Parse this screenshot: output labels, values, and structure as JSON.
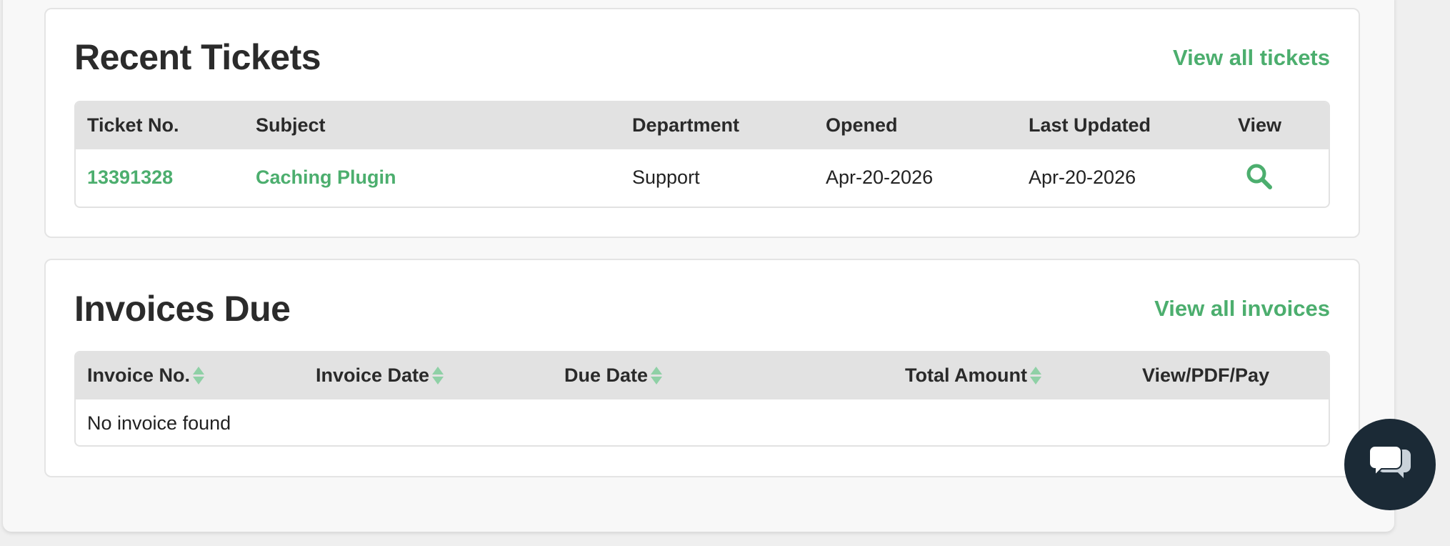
{
  "recent_tickets": {
    "title": "Recent Tickets",
    "view_all_label": "View all tickets",
    "columns": [
      "Ticket No.",
      "Subject",
      "Department",
      "Opened",
      "Last Updated",
      "View"
    ],
    "rows": [
      {
        "ticket_no": "13391328",
        "subject": "Caching Plugin",
        "department": "Support",
        "opened": "Apr-20-2026",
        "last_updated": "Apr-20-2026",
        "view_icon": "search-icon"
      }
    ]
  },
  "invoices_due": {
    "title": "Invoices Due",
    "view_all_label": "View all invoices",
    "columns": [
      "Invoice No.",
      "Invoice Date",
      "Due Date",
      "Total Amount",
      "View/PDF/Pay"
    ],
    "empty_message": "No invoice found"
  },
  "chat_widget": {
    "icon": "chat-bubbles-icon"
  },
  "colors": {
    "accent": "#4cae6e",
    "header_bg": "#e2e2e2",
    "chat_bg": "#1b2a36"
  }
}
